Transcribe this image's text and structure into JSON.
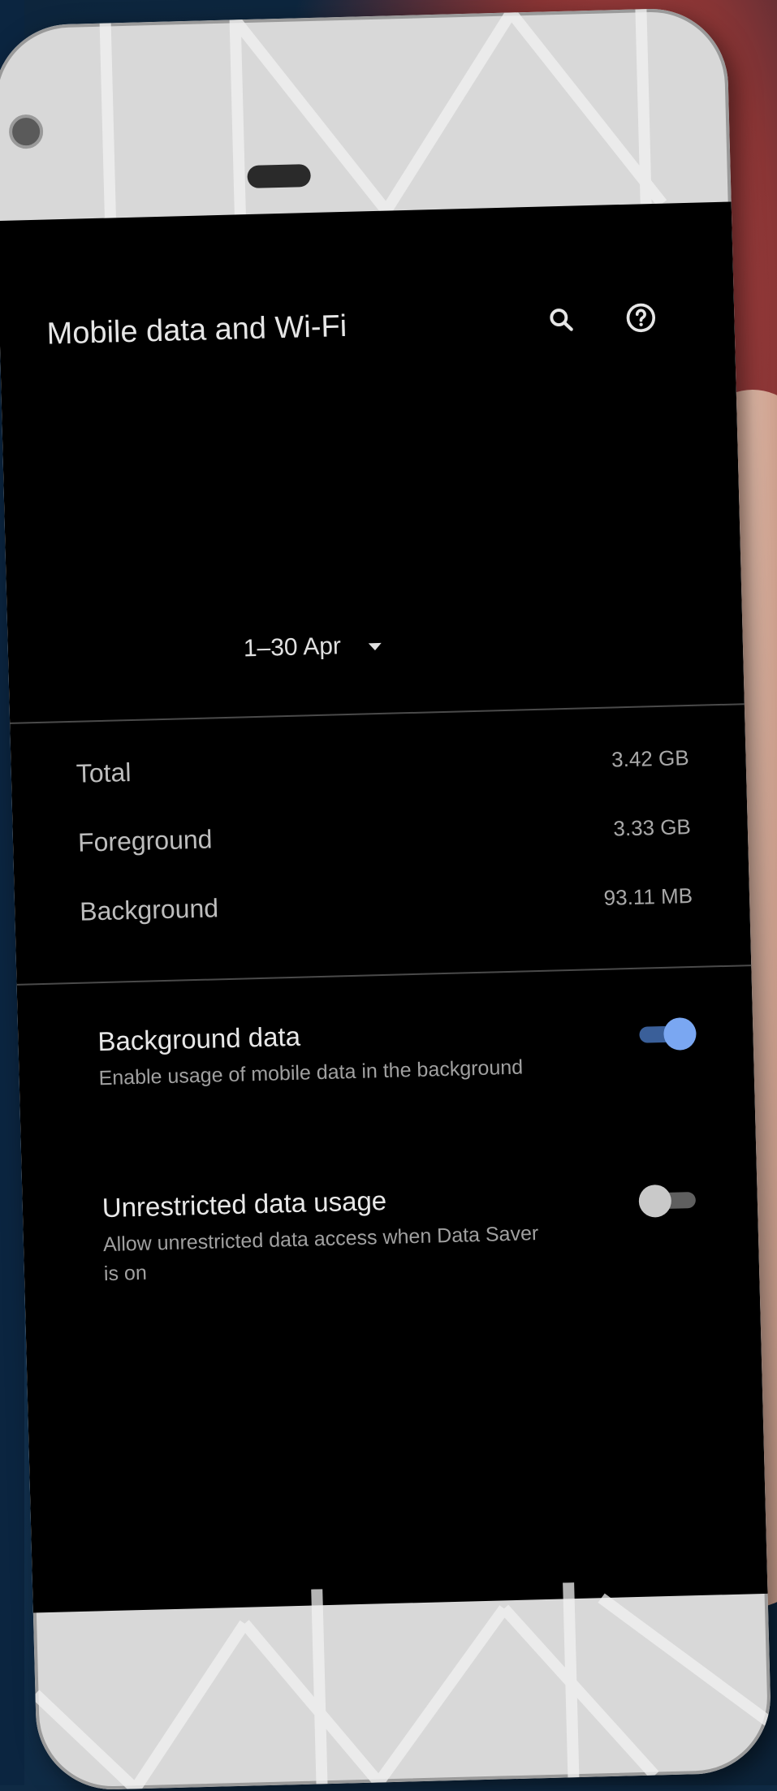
{
  "header": {
    "title": "Mobile data and Wi-Fi",
    "search_icon": "search-icon",
    "help_icon": "help-icon"
  },
  "period": {
    "label": "1–30 Apr",
    "icon": "caret-down-icon"
  },
  "usage": [
    {
      "label": "Total",
      "value": "3.42 GB"
    },
    {
      "label": "Foreground",
      "value": "3.33 GB"
    },
    {
      "label": "Background",
      "value": "93.11 MB"
    }
  ],
  "settings": [
    {
      "title": "Background data",
      "subtitle": "Enable usage of mobile data in the background",
      "enabled": true
    },
    {
      "title": "Unrestricted data usage",
      "subtitle": "Allow unrestricted data access when Data Saver is on",
      "enabled": false
    }
  ],
  "colors": {
    "screen_bg": "#000000",
    "accent": "#7aa7f2",
    "text_primary": "#e6e6e6",
    "text_secondary": "#a0a0a0"
  }
}
